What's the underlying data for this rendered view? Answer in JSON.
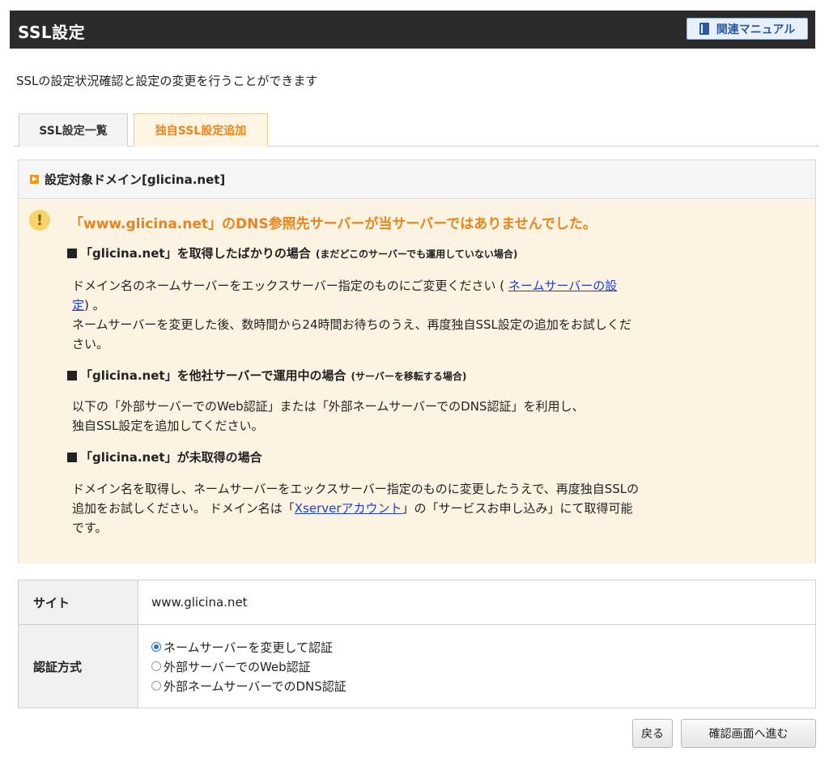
{
  "header": {
    "title": "SSL設定",
    "manual_label": "関連マニュアル"
  },
  "intro": "SSLの設定状況確認と設定の変更を行うことができます",
  "tabs": [
    {
      "label": "SSL設定一覧",
      "active": false
    },
    {
      "label": "独自SSL設定追加",
      "active": true
    }
  ],
  "panel": {
    "heading": "設定対象ドメイン[glicina.net]",
    "warning_title": "「www.glicina.net」のDNS参照先サーバーが当サーバーではありませんでした。",
    "case1": {
      "heading": "「glicina.net」を取得したばかりの場合",
      "sub": "(まだどこのサーバーでも運用していない場合)",
      "text_before_link": "ドメイン名のネームサーバーをエックスサーバー指定のものにご変更ください (",
      "link_line1": "ネームサーバーの設",
      "link_line2": "定",
      "text_after_link": ") 。",
      "text2_line1": "ネームサーバーを変更した後、数時間から24時間お待ちのうえ、再度独自SSL設定の追加をお試しくだ",
      "text2_line2": "さい。"
    },
    "case2": {
      "heading": "「glicina.net」を他社サーバーで運用中の場合",
      "sub": "(サーバーを移転する場合)",
      "line1": "以下の「外部サーバーでのWeb認証」または「外部ネームサーバーでのDNS認証」を利用し、",
      "line2": "独自SSL設定を追加してください。"
    },
    "case3": {
      "heading": "「glicina.net」が未取得の場合",
      "line1": "ドメイン名を取得し、ネームサーバーをエックスサーバー指定のものに変更したうえで、再度独自SSLの",
      "line2_before": "追加をお試しください。 ドメイン名は「",
      "line2_link": "Xserverアカウント",
      "line2_after": "」の「サービスお申し込み」にて取得可能",
      "line3": "です。"
    }
  },
  "table": {
    "site_label": "サイト",
    "site_value": "www.glicina.net",
    "auth_label": "認証方式",
    "auth_options": [
      {
        "label": "ネームサーバーを変更して認証",
        "selected": true
      },
      {
        "label": "外部サーバーでのWeb認証",
        "selected": false
      },
      {
        "label": "外部ネームサーバーでのDNS認証",
        "selected": false
      }
    ]
  },
  "buttons": {
    "back": "戻る",
    "next": "確認画面へ進む"
  },
  "colors": {
    "accent_orange": "#e8841a",
    "link_blue": "#1a3fcc",
    "header_bg": "#2b2b2b",
    "warning_bg": "#fdf3e2"
  }
}
